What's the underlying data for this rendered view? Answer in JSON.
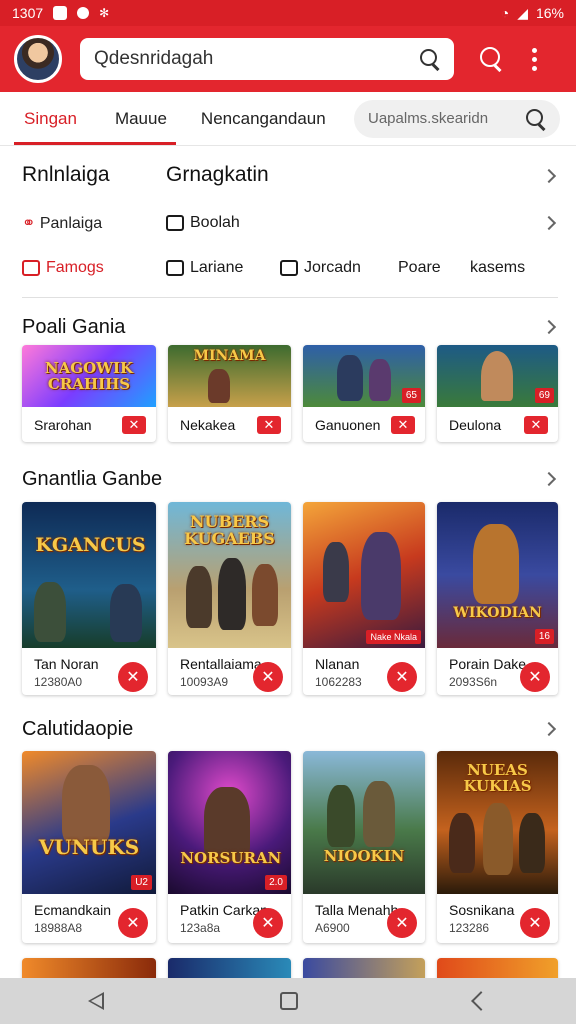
{
  "status_bar": {
    "time": "1307",
    "battery": "16%"
  },
  "app_bar": {
    "search_value": "Qdesnridagah"
  },
  "tabs": {
    "items": [
      {
        "label": "Singan",
        "active": true
      },
      {
        "label": "Mauue",
        "active": false
      },
      {
        "label": "Nencangandaun",
        "active": false
      }
    ],
    "search_placeholder": "Uapalms.skearidn"
  },
  "categories": {
    "heading_left": "Rnlnlaiga",
    "heading_right": "Grnagkatin",
    "row1": [
      "Panlaiga",
      "Boolah"
    ],
    "row2": [
      "Famogs",
      "Lariane",
      "Jorcadn",
      "Poare",
      "kasems"
    ]
  },
  "sections": [
    {
      "title": "Poali Gania",
      "cards": [
        {
          "logo": "NAGOWIK CRAHIHS",
          "label": "Srarohan",
          "badge": ""
        },
        {
          "logo": "MINAMA",
          "label": "Nekakea",
          "badge": ""
        },
        {
          "logo": "",
          "label": "Ganuonen",
          "badge": "65"
        },
        {
          "logo": "",
          "label": "Deulona",
          "badge": "69"
        }
      ]
    },
    {
      "title": "Gnantlia Ganbe",
      "cards": [
        {
          "logo": "KGANCUS",
          "label": "Tan Noran",
          "sub": "12380A0",
          "badge": ""
        },
        {
          "logo": "NUBERS KUGAEBS",
          "label": "Rentallaiama",
          "sub": "10093A9",
          "badge": ""
        },
        {
          "logo": "",
          "label": "Nlanan",
          "sub": "1062283",
          "badge": "Nake Nkala"
        },
        {
          "logo": "WIKODIAN",
          "label": "Porain Dake",
          "sub": "2093S6n",
          "badge": "16"
        }
      ]
    },
    {
      "title": "Calutidaopie",
      "cards": [
        {
          "logo": "VUNUKS",
          "label": "Ecmandkain",
          "sub": "18988A8",
          "badge": "U2"
        },
        {
          "logo": "NORSURAN",
          "label": "Patkin Carkan",
          "sub": "123a8a",
          "badge": "2.0"
        },
        {
          "logo": "NIOOKIN",
          "label": "Talla Menahh",
          "sub": "A6900",
          "badge": ""
        },
        {
          "logo": "NUEAS KUKIAS",
          "label": "Sosnikana",
          "sub": "123286",
          "badge": ""
        }
      ]
    }
  ],
  "colors": {
    "primary": "#d81f26",
    "appbar": "#e3262e",
    "navbar": "#d6d6d6"
  }
}
